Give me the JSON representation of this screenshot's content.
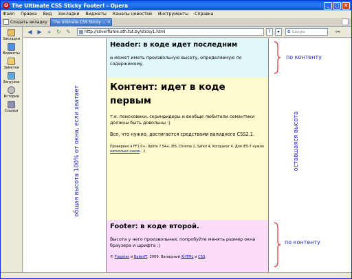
{
  "window": {
    "title": "The Ultimate CSS Sticky Footer! - Opera",
    "app_icon": "O"
  },
  "menu": [
    "Файл",
    "Правка",
    "Вид",
    "Закладки",
    "Виджеты",
    "Каналы новостей",
    "Инструменты",
    "Справка"
  ],
  "tabbar": {
    "new_tab_label": "Создать вкладку",
    "active_tab": "The Ultimate CSS Sticky ...",
    "close": "×"
  },
  "sidebar": [
    {
      "label": "Закладки",
      "icon": "bookmarks-icon",
      "color": "#e8c060"
    },
    {
      "label": "Виджеты",
      "icon": "widgets-icon",
      "color": "#5090e0"
    },
    {
      "label": "Заметки",
      "icon": "notes-icon",
      "color": "#f0d060"
    },
    {
      "label": "Загрузки",
      "icon": "downloads-icon",
      "color": "#60a8e0"
    },
    {
      "label": "История",
      "icon": "history-icon",
      "color": "#c0c0c0"
    },
    {
      "label": "Ссылки",
      "icon": "links-icon",
      "color": "#9090b0"
    }
  ],
  "toolbar": {
    "url": "http://silverflame.ath.tut.by/sticky1.html",
    "search_placeholder": "Google",
    "search_g": "G",
    "help": "?",
    "dropdown": "▾"
  },
  "page": {
    "header_title": "Header: в коде идет последним",
    "header_text": "и может иметь произвольную высоту, определяемую по содержимому.",
    "content_title": "Контент: идет в коде первым",
    "content_p1": "т.е. поисковики, скринридеры и вообще любители семантики должны быть довольны :)",
    "content_p2": "Все, что нужно, достигается средствами валидного CSS2.1.",
    "content_p3_start": "Проверено в FF1.0+, Opera 7.54+, IE6, Chrome 2, Safari 4, Konqueror 4. Для IE5-7 нужно ",
    "content_p3_link": "несколько хаков",
    "content_p3_end": ".. :)",
    "footer_title": "Footer: в коде второй.",
    "footer_text": "Высота у него произвольная, попробуйте менять размер окна браузера и шрифта ;)",
    "footer_copy_1": "© ",
    "footer_link1": "Fragster",
    "footer_and": " и ",
    "footer_link2": "BalenIT",
    "footer_copy_2": ", 2009. Валидный ",
    "footer_link3": "XHTML",
    "footer_and2": " и ",
    "footer_link4": "CSS"
  },
  "annotations": {
    "left_vertical": "общая высота 100% от окна, если хватает",
    "right_vertical": "оставшаяся высота",
    "header_note": "по контенту",
    "footer_note": "по контенту"
  },
  "colors": {
    "header_bg": "#e0f8fa",
    "content_bg": "#fdfacd",
    "footer_bg": "#fcdcfb",
    "annotation": "#1f1fd0",
    "brace": "#e03030"
  }
}
